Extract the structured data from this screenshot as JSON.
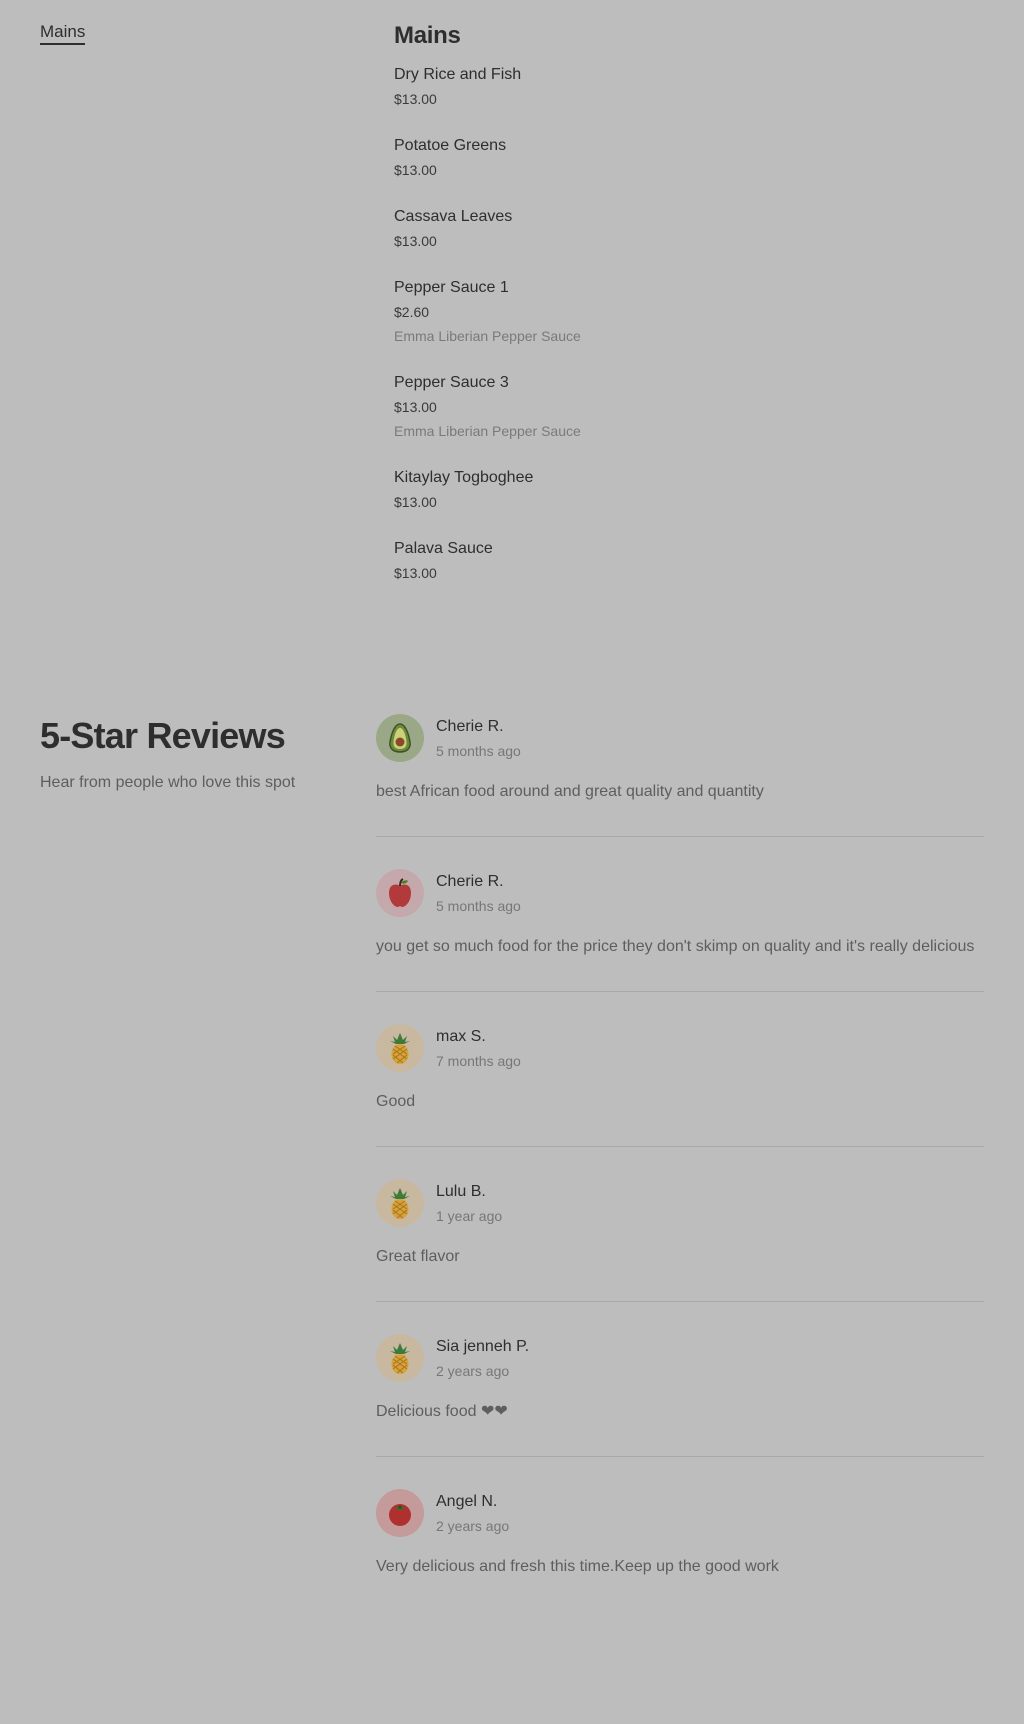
{
  "nav": {
    "active_category": "Mains"
  },
  "menu": {
    "title": "Mains",
    "items": [
      {
        "name": "Dry Rice and Fish",
        "price": "$13.00",
        "description": ""
      },
      {
        "name": "Potatoe Greens",
        "price": "$13.00",
        "description": ""
      },
      {
        "name": "Cassava Leaves",
        "price": "$13.00",
        "description": ""
      },
      {
        "name": "Pepper Sauce 1",
        "price": "$2.60",
        "description": "Emma Liberian Pepper Sauce"
      },
      {
        "name": "Pepper Sauce 3",
        "price": "$13.00",
        "description": "Emma Liberian Pepper Sauce"
      },
      {
        "name": "Kitaylay Togboghee",
        "price": "$13.00",
        "description": ""
      },
      {
        "name": "Palava Sauce",
        "price": "$13.00",
        "description": ""
      }
    ]
  },
  "reviews": {
    "title": "5-Star Reviews",
    "subtitle": "Hear from people who love this spot",
    "items": [
      {
        "name": "Cherie R.",
        "time": "5 months ago",
        "avatar": "avocado-icon",
        "text": "best African food around and great quality and quantity"
      },
      {
        "name": "Cherie R.",
        "time": "5 months ago",
        "avatar": "apple-icon",
        "text": "you get so much food for the price they don't skimp on quality and it's really delicious"
      },
      {
        "name": "max S.",
        "time": "7 months ago",
        "avatar": "pineapple-icon",
        "text": "Good"
      },
      {
        "name": "Lulu B.",
        "time": "1 year ago",
        "avatar": "pineapple-icon",
        "text": "Great flavor"
      },
      {
        "name": "Sia jenneh P.",
        "time": "2 years ago",
        "avatar": "pineapple-icon",
        "text": "Delicious food ❤❤"
      },
      {
        "name": "Angel N.",
        "time": "2 years ago",
        "avatar": "tomato-icon",
        "text": "Very delicious and fresh this time.Keep up the good work"
      }
    ]
  },
  "colors": {
    "page_background": "#bdbdbd",
    "text_primary": "#2e2e2e",
    "text_secondary": "#5e5e5e"
  }
}
